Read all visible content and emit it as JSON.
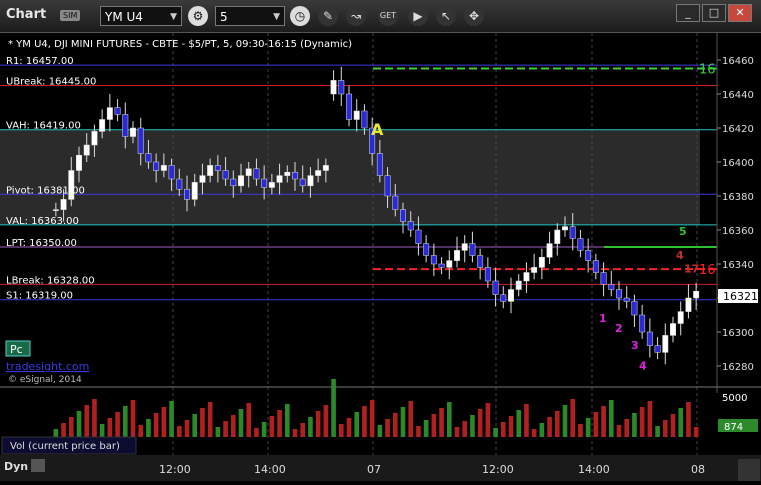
{
  "window": {
    "title": "Chart",
    "badge": "SIM",
    "symbol": "YM U4",
    "interval": "5",
    "buttons": {
      "minimize": "_",
      "maximize": "□",
      "close": "✕"
    },
    "icons": [
      "settings-icon",
      "clock-icon",
      "draw-icon",
      "add-indicator-icon",
      "get-icon",
      "play-icon",
      "cursor-icon",
      "pin-icon"
    ]
  },
  "chart_data": {
    "type": "candlestick",
    "title": "* YM U4, DJI MINI FUTURES - CBTE - $5/PT, 5, 09:30-16:15 (Dynamic)",
    "ylim": [
      16270,
      16465
    ],
    "ytick_labels": [
      "16460",
      "16440",
      "16420",
      "16400",
      "16380",
      "16360",
      "16340",
      "16320",
      "16300",
      "16280"
    ],
    "current_price": "16321",
    "x_tick_labels": [
      "12:00",
      "14:00",
      "07",
      "12:00",
      "14:00",
      "08"
    ],
    "levels": [
      {
        "label": "R1: 16457.00",
        "value": 16457,
        "color": "#3a3adf"
      },
      {
        "label": "UBreak: 16445.00",
        "value": 16445,
        "color": "#d12020"
      },
      {
        "label": "VAH: 16419.00",
        "value": 16419,
        "color": "#20c8c8"
      },
      {
        "label": "Pivot: 16381.00",
        "value": 16381,
        "color": "#3a3adf"
      },
      {
        "label": "VAL: 16363.00",
        "value": 16363,
        "color": "#20c8c8"
      },
      {
        "label": "LPT: 16350.00",
        "value": 16350,
        "color": "#a060c0"
      },
      {
        "label": "LBreak: 16328.00",
        "value": 16328,
        "color": "#d12020"
      },
      {
        "label": "S1: 16319.00",
        "value": 16319,
        "color": "#3a3adf"
      }
    ],
    "right_levels": [
      {
        "value": 16455,
        "color": "#3ad03a",
        "label": "16",
        "dash": true
      },
      {
        "value": 16337,
        "color": "#ff2020",
        "label": "16",
        "dash": true
      },
      {
        "value": 16350,
        "color": "#30c030",
        "label": "",
        "dash": false
      }
    ],
    "annotations": [
      {
        "text": "A",
        "color": "#e8e830"
      },
      {
        "text": "1",
        "color": "#e020e0"
      },
      {
        "text": "2",
        "color": "#e020e0"
      },
      {
        "text": "3",
        "color": "#e020e0"
      },
      {
        "text": "4",
        "color": "#e020e0"
      },
      {
        "text": "5",
        "color": "#30c030"
      },
      {
        "text": "4",
        "color": "#c03030"
      },
      {
        "text": "17",
        "color": "#c03030"
      }
    ],
    "pc_label": "Pc",
    "watermark": "tradesight.com",
    "copyright": "© eSignal, 2014",
    "volume": {
      "label": "Vol (current price bar)",
      "ytick": "5000",
      "current": "874"
    },
    "footer_label": "Dyn"
  }
}
